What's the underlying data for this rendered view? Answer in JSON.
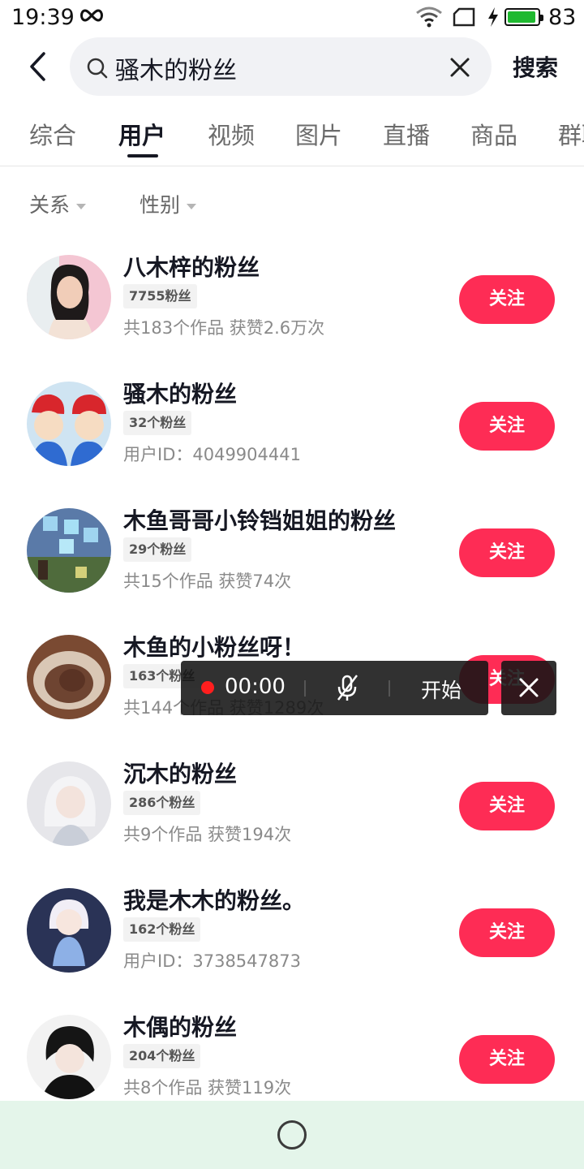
{
  "status_bar": {
    "time": "19:39",
    "battery": "83"
  },
  "search": {
    "query": "骚木的粉丝",
    "submit_label": "搜索"
  },
  "tabs": [
    {
      "label": "综合"
    },
    {
      "label": "用户"
    },
    {
      "label": "视频"
    },
    {
      "label": "图片"
    },
    {
      "label": "直播"
    },
    {
      "label": "商品"
    },
    {
      "label": "群聊"
    }
  ],
  "filters": [
    {
      "label": "关系"
    },
    {
      "label": "性别"
    }
  ],
  "users": [
    {
      "name": "八木梓的粉丝",
      "followers": "7755粉丝",
      "meta": "共183个作品 获赞2.6万次",
      "follow_label": "关注"
    },
    {
      "name": "骚木的粉丝",
      "followers": "32个粉丝",
      "meta": "用户ID：4049904441",
      "follow_label": "关注"
    },
    {
      "name": "木鱼哥哥小铃铛姐姐的粉丝",
      "followers": "29个粉丝",
      "meta": "共15个作品 获赞74次",
      "follow_label": "关注"
    },
    {
      "name": "木鱼的小粉丝呀！",
      "followers": "163个粉丝",
      "meta": "共144个作品 获赞1289次",
      "follow_label": "关注"
    },
    {
      "name": "沉木的粉丝",
      "followers": "286个粉丝",
      "meta": "共9个作品 获赞194次",
      "follow_label": "关注"
    },
    {
      "name": "我是木木的粉丝。",
      "followers": "162个粉丝",
      "meta": "用户ID：3738547873",
      "follow_label": "关注"
    },
    {
      "name": "木偶的粉丝",
      "followers": "204个粉丝",
      "meta": "共8个作品 获赞119次",
      "follow_label": "关注"
    }
  ],
  "recorder": {
    "time": "00:00",
    "start_label": "开始"
  },
  "colors": {
    "accent": "#fe2c55",
    "nav_bar": "#e4f5ea",
    "battery": "#1fb930"
  }
}
